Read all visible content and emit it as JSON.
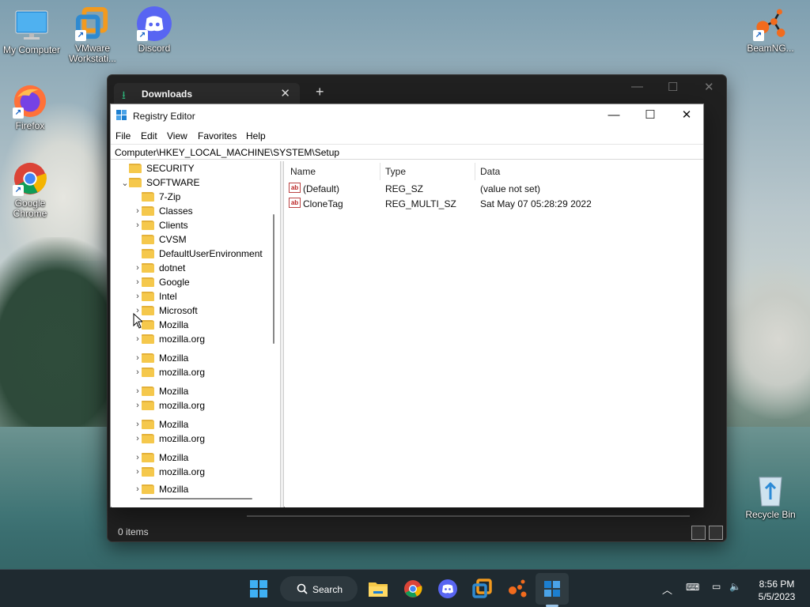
{
  "desktop": {
    "icons": [
      {
        "label": "My Computer"
      },
      {
        "label": "VMware Workstati..."
      },
      {
        "label": "Discord"
      },
      {
        "label": "Firefox"
      },
      {
        "label": "Google Chrome"
      },
      {
        "label": "BeamNG..."
      },
      {
        "label": "Recycle Bin"
      }
    ]
  },
  "explorer": {
    "tab_title": "Downloads",
    "status": "0 items"
  },
  "regedit": {
    "title": "Registry Editor",
    "menu": [
      "File",
      "Edit",
      "View",
      "Favorites",
      "Help"
    ],
    "address": "Computer\\HKEY_LOCAL_MACHINE\\SYSTEM\\Setup",
    "tree": [
      {
        "label": "SECURITY"
      },
      {
        "label": "SOFTWARE"
      },
      {
        "label": "7-Zip"
      },
      {
        "label": "Classes"
      },
      {
        "label": "Clients"
      },
      {
        "label": "CVSM"
      },
      {
        "label": "DefaultUserEnvironment"
      },
      {
        "label": "dotnet"
      },
      {
        "label": "Google"
      },
      {
        "label": "Intel"
      },
      {
        "label": "Microsoft"
      },
      {
        "label": "Mozilla"
      },
      {
        "label": "mozilla.org"
      },
      {
        "label": "Mozilla"
      },
      {
        "label": "mozilla.org"
      },
      {
        "label": "Mozilla"
      },
      {
        "label": "mozilla.org"
      },
      {
        "label": "Mozilla"
      },
      {
        "label": "mozilla.org"
      },
      {
        "label": "Mozilla"
      },
      {
        "label": "mozilla.org"
      },
      {
        "label": "Mozilla"
      }
    ],
    "columns": [
      "Name",
      "Type",
      "Data"
    ],
    "values": [
      {
        "name": "(Default)",
        "type": "REG_SZ",
        "data": "(value not set)"
      },
      {
        "name": "CloneTag",
        "type": "REG_MULTI_SZ",
        "data": "Sat May 07 05:28:29 2022"
      }
    ]
  },
  "taskbar": {
    "search_label": "Search",
    "time": "8:56 PM",
    "date": "5/5/2023"
  }
}
